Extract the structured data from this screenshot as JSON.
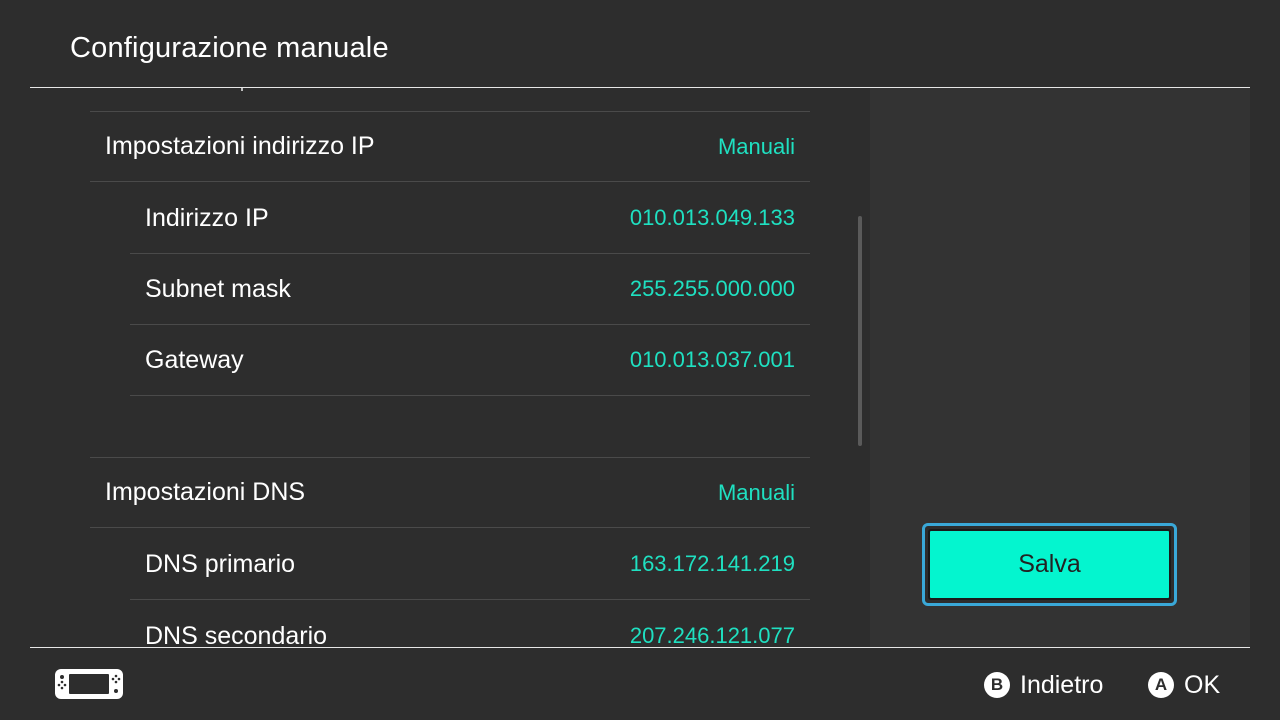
{
  "header": {
    "title": "Configurazione manuale"
  },
  "settings": {
    "ip_settings": {
      "label": "Impostazioni indirizzo IP",
      "value": "Manuali"
    },
    "ip_address": {
      "label": "Indirizzo IP",
      "value": "010.013.049.133"
    },
    "subnet_mask": {
      "label": "Subnet mask",
      "value": "255.255.000.000"
    },
    "gateway": {
      "label": "Gateway",
      "value": "010.013.037.001"
    },
    "dns_settings": {
      "label": "Impostazioni DNS",
      "value": "Manuali"
    },
    "dns_primary": {
      "label": "DNS primario",
      "value": "163.172.141.219"
    },
    "dns_secondary": {
      "label": "DNS secondario",
      "value": "207.246.121.077"
    }
  },
  "actions": {
    "save_label": "Salva"
  },
  "footer": {
    "console_icon": "handheld-console-icon",
    "back": {
      "button": "B",
      "label": "Indietro"
    },
    "ok": {
      "button": "A",
      "label": "OK"
    }
  },
  "colors": {
    "background": "#2d2d2d",
    "accent": "#1fe0c1",
    "button_fill": "#04f5cf",
    "focus_border": "#3aa8d8"
  }
}
